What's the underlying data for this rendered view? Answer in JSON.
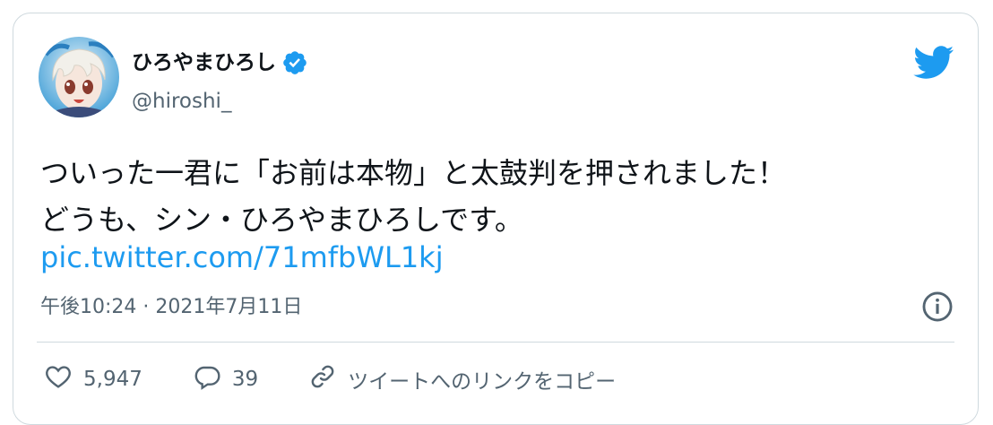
{
  "author": {
    "display_name": "ひろやまひろし",
    "handle": "@hiroshi_",
    "verified": true,
    "avatar_icon": "anime-character-avatar"
  },
  "brand_icon": "twitter-bird-icon",
  "tweet": {
    "text": "ついった一君に「お前は本物」と太鼓判を押されました！\nどうも、シン・ひろやまひろしです。",
    "link": "pic.twitter.com/71mfbWL1kj"
  },
  "meta": {
    "timestamp": "午後10:24 · 2021年7月11日"
  },
  "actions": {
    "likes": "5,947",
    "replies": "39",
    "copy_link_label": "ツイートへのリンクをコピー"
  },
  "colors": {
    "accent": "#1d9bf0",
    "text": "#0f1419",
    "secondary": "#536471",
    "border": "#cfd9de"
  }
}
